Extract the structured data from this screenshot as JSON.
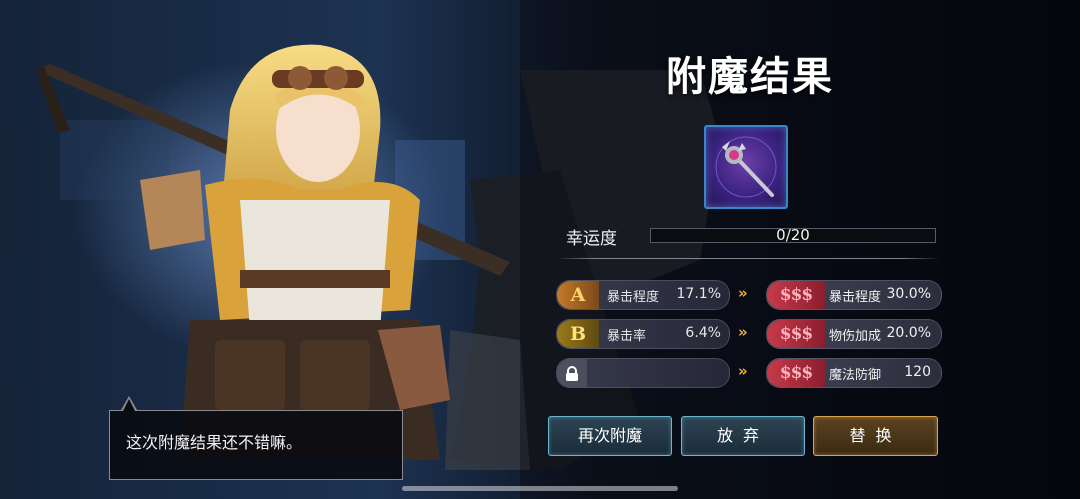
{
  "title": "附魔结果",
  "item": {
    "icon": "magic-scepter-icon"
  },
  "luck": {
    "label": "幸运度",
    "value_text": "0/20",
    "progress": 0
  },
  "current_stats": [
    {
      "grade": "A",
      "name": "暴击程度",
      "value": "17.1%"
    },
    {
      "grade": "B",
      "name": "暴击率",
      "value": "6.4%"
    },
    {
      "grade": "",
      "name": "",
      "value": "",
      "locked": true
    }
  ],
  "arrow": "»",
  "new_stats": [
    {
      "grade": "$$$",
      "name": "暴击程度",
      "value": "30.0%"
    },
    {
      "grade": "$$$",
      "name": "物伤加成",
      "value": "20.0%"
    },
    {
      "grade": "$$$",
      "name": "魔法防御",
      "value": "120"
    }
  ],
  "buttons": {
    "reenchant": "再次附魔",
    "abandon": "放弃",
    "replace": "替换"
  },
  "dialog": {
    "text": "这次附魔结果还不错嘛。"
  },
  "colors": {
    "grade_a": "#c57a2a",
    "grade_b": "#9a7a1a",
    "grade_sss": "#c73a4a",
    "arrow": "#f0b43c",
    "replace_border": "#d9a352",
    "button_border": "#6fb5cc"
  }
}
